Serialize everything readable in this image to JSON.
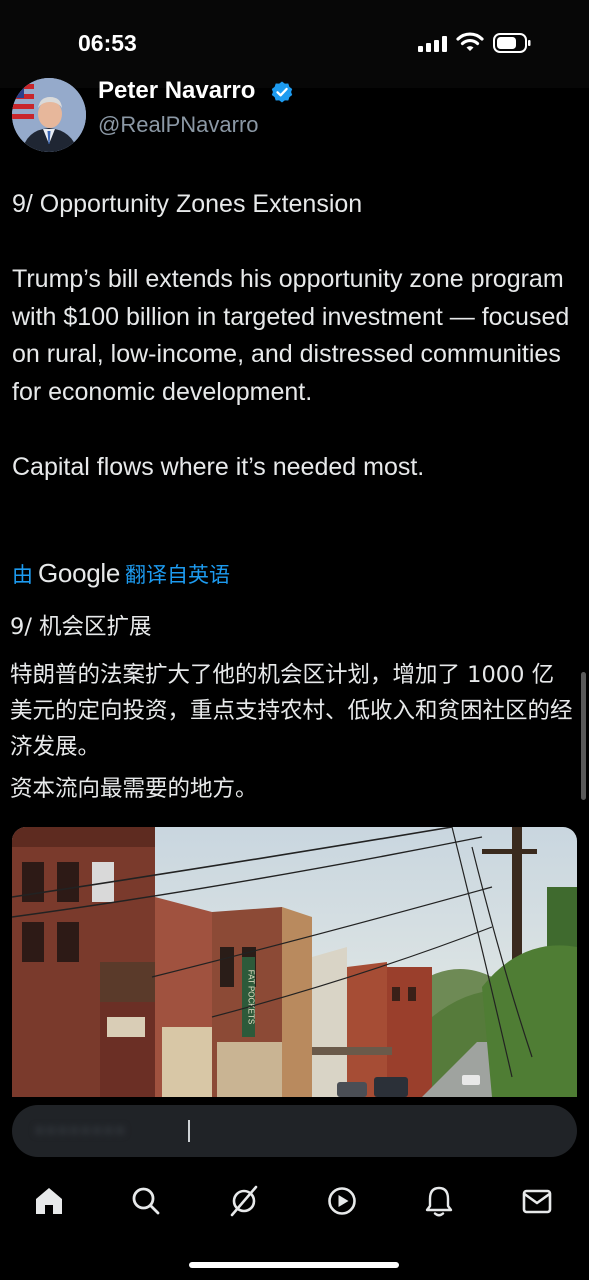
{
  "status_bar": {
    "time": "06:53"
  },
  "author": {
    "display_name": "Peter Navarro",
    "handle": "@RealPNavarro",
    "verified": true
  },
  "post": {
    "title": "9/ Opportunity Zones Extension",
    "body": "Trump’s bill extends his opportunity zone program with $100 billion in targeted investment — focused on rural, low-income, and distressed communities for economic development.",
    "closing": "Capital flows where it’s needed most."
  },
  "translation_notice": {
    "prefix": "由",
    "provider": "Google",
    "suffix": "翻译自英语"
  },
  "translated": {
    "title": "9/ 机会区扩展",
    "body": "特朗普的法案扩大了他的机会区计划，增加了 1000 亿美元的定向投资，重点支持农村、低收入和贫困社区的经济发展。",
    "closing": "资本流向最需要的地方。"
  },
  "media": {
    "sign_text": "FAT POCKETS"
  },
  "colors": {
    "background": "#000000",
    "text": "#e7e9ea",
    "muted": "#8b98a5",
    "accent": "#1d9bf0"
  },
  "tab_bar": {
    "tabs": [
      {
        "icon": "home-icon"
      },
      {
        "icon": "search-icon"
      },
      {
        "icon": "grok-icon"
      },
      {
        "icon": "video-icon"
      },
      {
        "icon": "notifications-bell-icon"
      },
      {
        "icon": "messages-icon"
      }
    ]
  }
}
